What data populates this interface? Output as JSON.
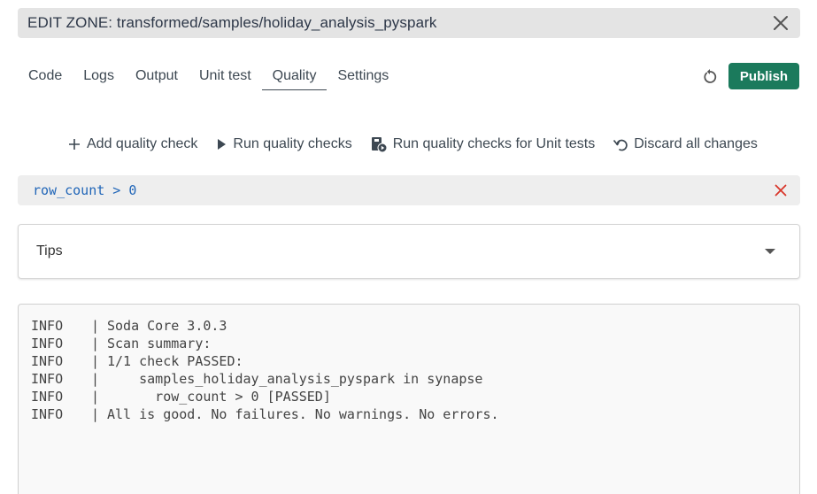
{
  "header": {
    "title": "EDIT ZONE: transformed/samples/holiday_analysis_pyspark",
    "close_icon": "close-icon"
  },
  "tabs": [
    {
      "label": "Code",
      "active": false
    },
    {
      "label": "Logs",
      "active": false
    },
    {
      "label": "Output",
      "active": false
    },
    {
      "label": "Unit test",
      "active": false
    },
    {
      "label": "Quality",
      "active": true
    },
    {
      "label": "Settings",
      "active": false
    }
  ],
  "toolbar": {
    "refresh_icon": "refresh-icon",
    "publish_label": "Publish",
    "publish_color": "#1b7a5c"
  },
  "actions": [
    {
      "label": "Add quality check",
      "icon": "plus-icon"
    },
    {
      "label": "Run quality checks",
      "icon": "play-icon"
    },
    {
      "label": "Run quality checks for Unit tests",
      "icon": "flask-run-icon"
    },
    {
      "label": "Discard all changes",
      "icon": "undo-icon"
    }
  ],
  "query": {
    "text": "row_count > 0",
    "delete_icon": "delete-x-icon",
    "text_color": "#2166b8",
    "delete_color": "#d9372b"
  },
  "tips": {
    "label": "Tips",
    "icon": "caret-down-icon"
  },
  "console": {
    "lines": [
      {
        "level": "INFO",
        "sep": "|",
        "message": "Soda Core 3.0.3"
      },
      {
        "level": "INFO",
        "sep": "|",
        "message": "Scan summary:"
      },
      {
        "level": "INFO",
        "sep": "|",
        "message": "1/1 check PASSED:"
      },
      {
        "level": "INFO",
        "sep": "|",
        "message": "    samples_holiday_analysis_pyspark in synapse"
      },
      {
        "level": "INFO",
        "sep": "|",
        "message": "      row_count > 0 [PASSED]"
      },
      {
        "level": "INFO",
        "sep": "|",
        "message": "All is good. No failures. No warnings. No errors."
      }
    ]
  }
}
